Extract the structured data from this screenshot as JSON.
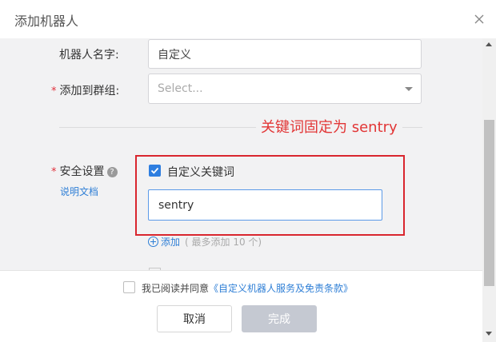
{
  "dialog": {
    "title": "添加机器人"
  },
  "form": {
    "name_label": "机器人名字:",
    "name_value": "自定义",
    "group_required_mark": "*",
    "group_label": "添加到群组:",
    "group_placeholder": "Select...",
    "annotation": "关键词固定为 sentry",
    "security_required_mark": "*",
    "security_label": "安全设置",
    "help_glyph": "?",
    "doc_link": "说明文档",
    "keyword_option_label": "自定义关键词",
    "keyword_option_checked": true,
    "keyword_value": "sentry",
    "add_link": "添加",
    "add_hint": "( 最多添加 10 个)"
  },
  "footer": {
    "agree_prefix": "我已阅读并同意",
    "agree_link": "《自定义机器人服务及免责条款》",
    "agree_checked": false,
    "cancel_label": "取消",
    "done_label": "完成"
  },
  "colors": {
    "accent": "#2e7ee0",
    "annotation_red": "#e23636",
    "form_background": "#f2f2f3",
    "disabled_button": "#c5c9d2"
  }
}
